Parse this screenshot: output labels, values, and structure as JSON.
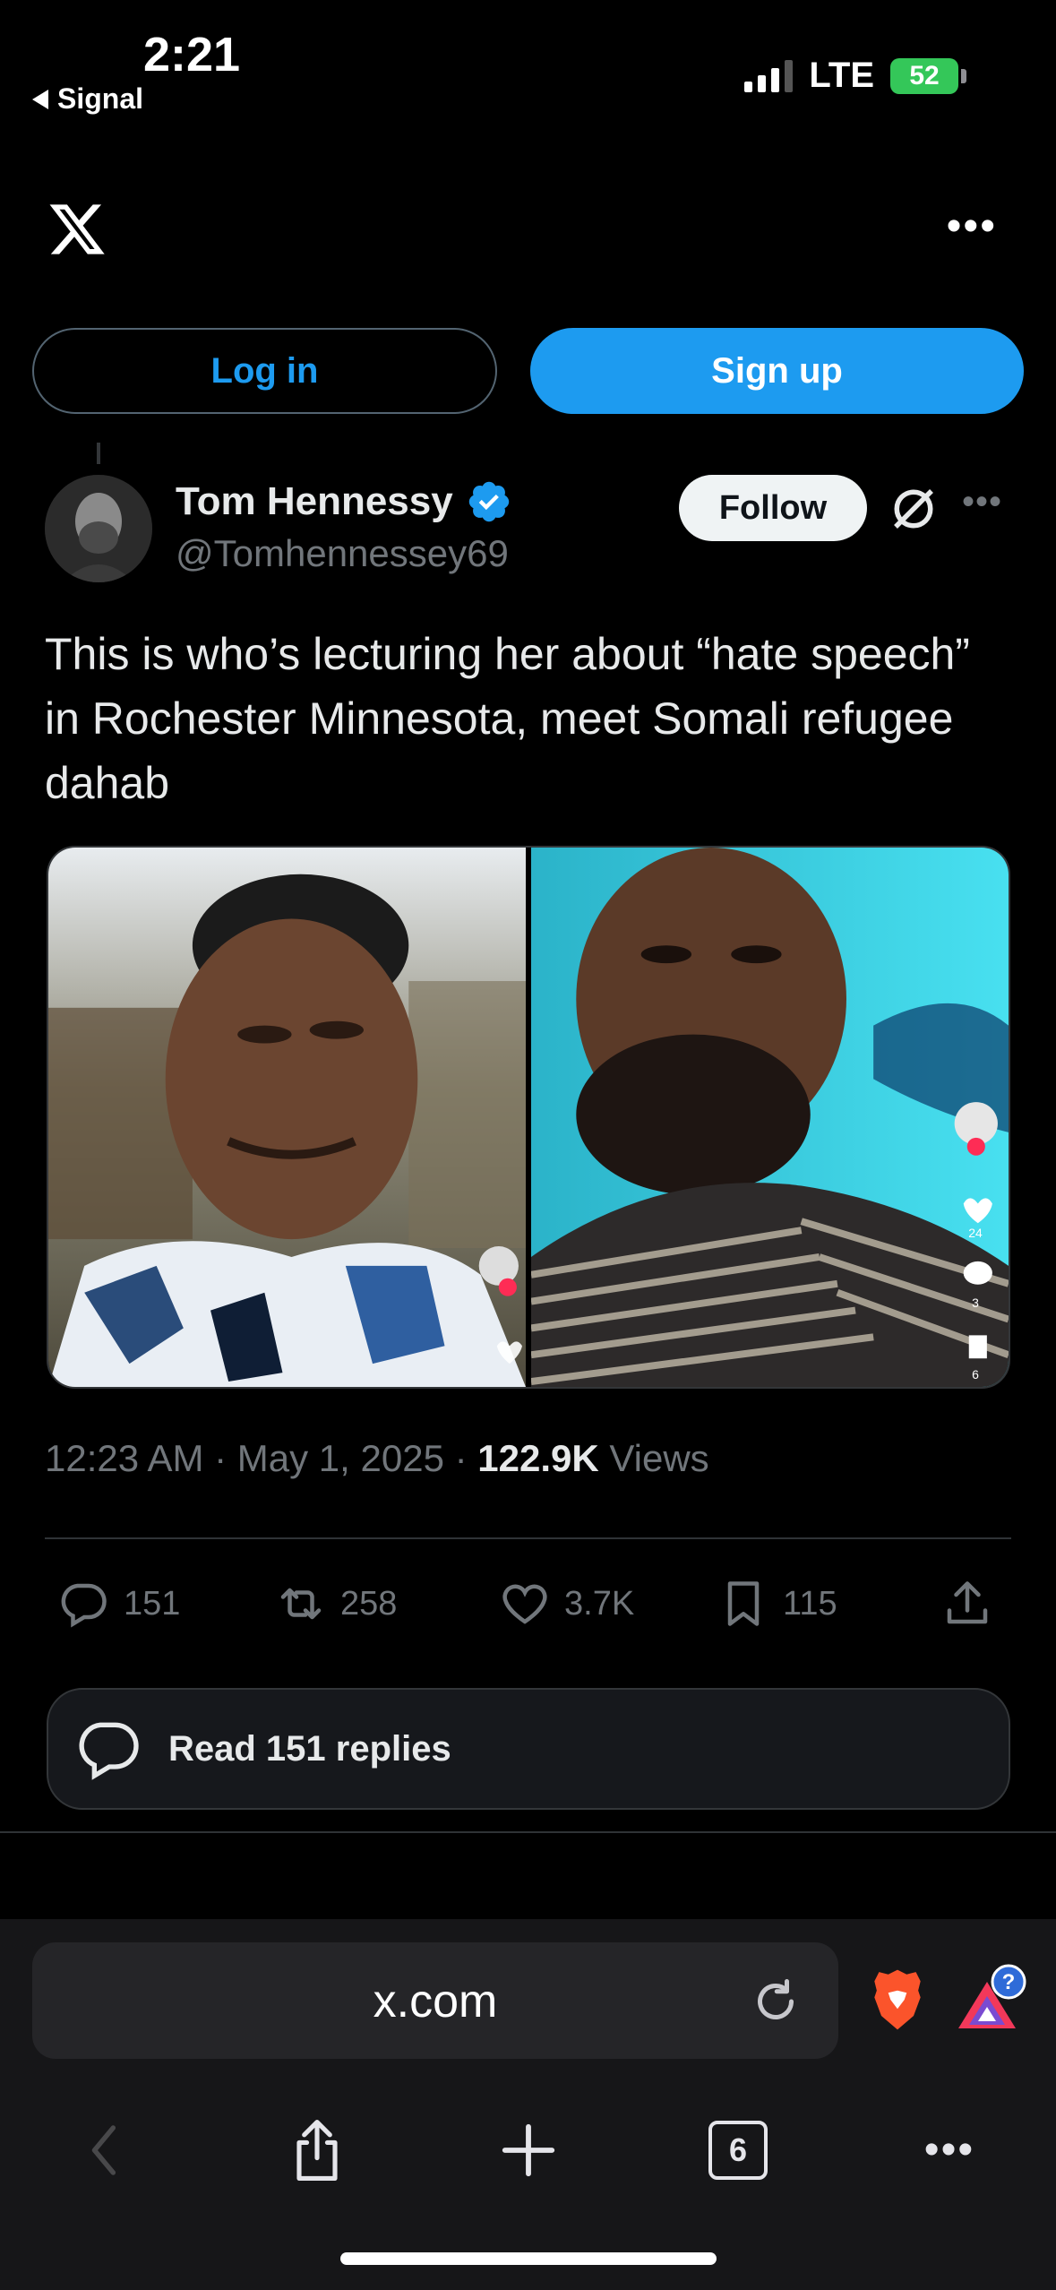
{
  "status_bar": {
    "time": "2:21",
    "back_app": "Signal",
    "network": "LTE",
    "battery": "52"
  },
  "auth": {
    "login_label": "Log in",
    "signup_label": "Sign up"
  },
  "post": {
    "author_name": "Tom Hennessy",
    "author_handle": "@Tomhennessey69",
    "follow_label": "Follow",
    "text": "This is who’s lecturing her about “hate speech” in Rochester Minnesota, meet Somali refugee dahab",
    "time": "12:23 AM",
    "date": "May 1, 2025",
    "views_count": "122.9K",
    "views_label": "Views",
    "media_right_counts": {
      "likes": "24",
      "comments": "3",
      "saves": "6"
    },
    "actions": {
      "replies": "151",
      "reposts": "258",
      "likes": "3.7K",
      "bookmarks": "115"
    },
    "read_replies_label": "Read 151 replies"
  },
  "browser": {
    "url": "x.com",
    "tab_count": "6"
  },
  "colors": {
    "accent": "#1d9bf0",
    "background": "#000000",
    "muted_text": "#71767b",
    "battery_green": "#34c759",
    "brave_orange": "#fb542b"
  }
}
